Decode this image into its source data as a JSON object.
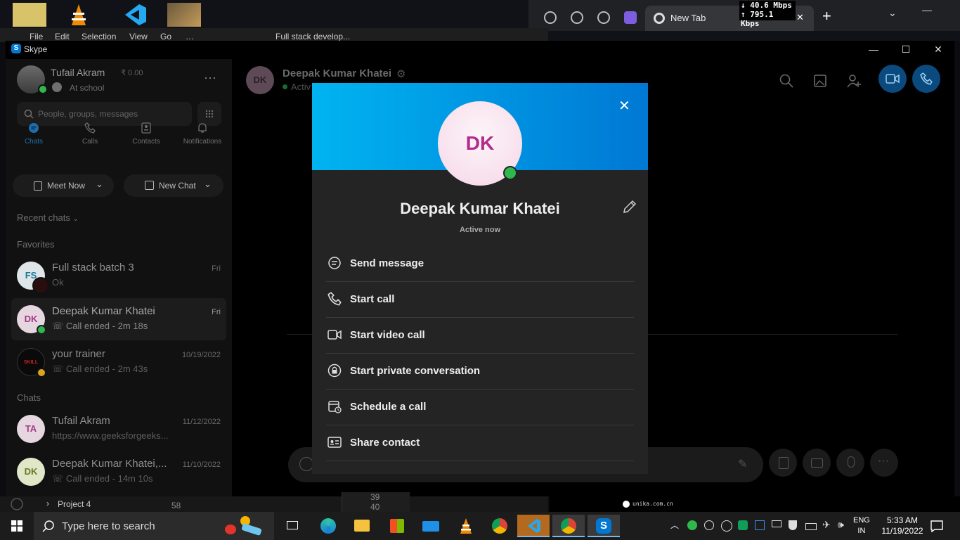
{
  "browser": {
    "tab_title": "New Tab",
    "tab_close": "✕",
    "new_tab": "+",
    "net_down": "↓ 40.6 Mbps",
    "net_up": "↑ 795.1 Kbps"
  },
  "vscode": {
    "menu": [
      "File",
      "Edit",
      "Selection",
      "View",
      "Go",
      "…"
    ],
    "search": "Full stack develop...",
    "explorer_item": "Project 4",
    "line_numbers": [
      "58",
      "39",
      "40"
    ]
  },
  "skype": {
    "window_title": "Skype",
    "window_controls": {
      "minimize": "—",
      "maximize": "☐",
      "close": "✕"
    },
    "profile": {
      "name": "Tufail Akram",
      "credit": "₹ 0.00",
      "mood": "At school"
    },
    "search_placeholder": "People, groups, messages",
    "nav": [
      {
        "label": "Chats",
        "icon": "chat-icon",
        "active": true
      },
      {
        "label": "Calls",
        "icon": "phone-icon",
        "active": false
      },
      {
        "label": "Contacts",
        "icon": "contacts-icon",
        "active": false
      },
      {
        "label": "Notifications",
        "icon": "bell-icon",
        "active": false
      }
    ],
    "meet_now": "Meet Now",
    "new_chat": "New Chat",
    "recent_chats": "Recent chats",
    "favorites_label": "Favorites",
    "chats_label": "Chats",
    "favorites": [
      {
        "initials": "FS",
        "name": "Full stack batch 3",
        "preview": "Ok",
        "date": "Fri"
      },
      {
        "initials": "DK",
        "name": "Deepak Kumar Khatei",
        "preview": "Call ended - 2m 18s",
        "date": "Fri"
      },
      {
        "initials": "SKILL",
        "name": "your trainer",
        "preview": "Call ended - 2m 43s",
        "date": "10/19/2022"
      }
    ],
    "chats": [
      {
        "initials": "TA",
        "name": "Tufail Akram",
        "preview": "https://www.geeksforgeeks...",
        "date": "11/12/2022"
      },
      {
        "initials": "DK",
        "name": "Deepak Kumar Khatei,...",
        "preview": "Call ended - 14m 10s",
        "date": "11/10/2022"
      }
    ],
    "conversation": {
      "initials": "DK",
      "name": "Deepak Kumar Khatei",
      "status": "Activ"
    }
  },
  "profile_card": {
    "initials": "DK",
    "name": "Deepak Kumar Khatei",
    "status": "Active now",
    "close": "✕",
    "actions": [
      {
        "label": "Send message",
        "icon": "message-icon"
      },
      {
        "label": "Start call",
        "icon": "phone-icon"
      },
      {
        "label": "Start video call",
        "icon": "video-icon"
      },
      {
        "label": "Start private conversation",
        "icon": "lock-icon"
      },
      {
        "label": "Schedule a call",
        "icon": "calendar-clock-icon"
      },
      {
        "label": "Share contact",
        "icon": "contact-card-icon"
      }
    ]
  },
  "bottom_right_text": "unika.com.cn",
  "taskbar": {
    "search_placeholder": "Type here to search",
    "lang": "ENG",
    "region": "IN",
    "time": "5:33 AM",
    "date": "11/19/2022"
  },
  "colors": {
    "skype_blue": "#0078d4",
    "banner_start": "#00b4f0",
    "presence_green": "#2fb84e",
    "avatar_text": "#b22c8e"
  }
}
